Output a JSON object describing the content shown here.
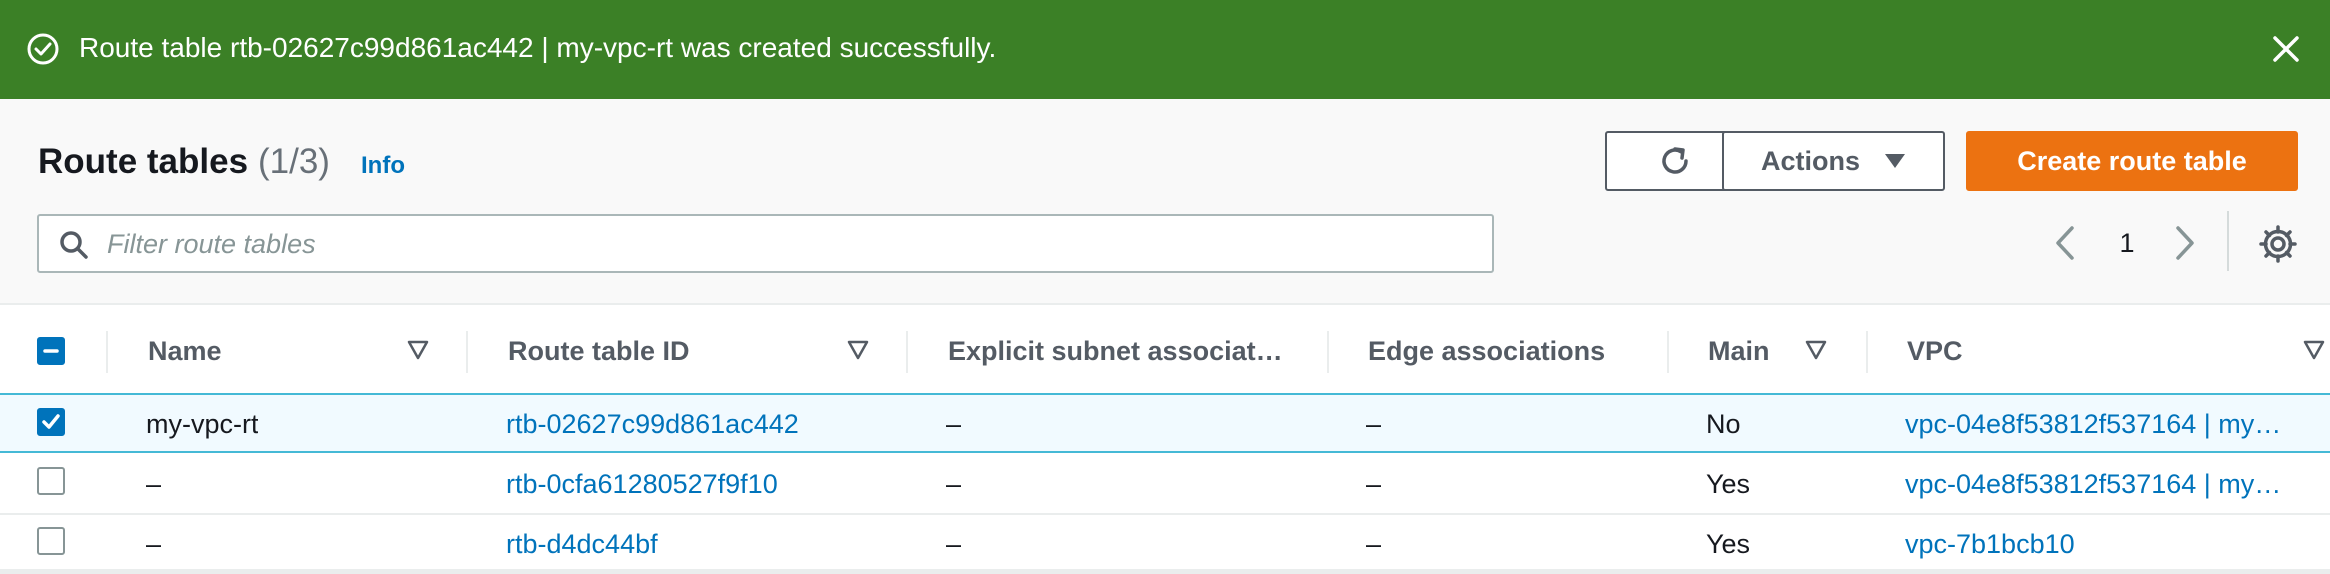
{
  "flash": {
    "message": "Route table rtb-02627c99d861ac442 | my-vpc-rt was created successfully.",
    "type": "success",
    "color": "#3b8026",
    "icon": "check-circle-icon",
    "close_icon": "close-icon"
  },
  "header": {
    "title": "Route tables",
    "count": "(1/3)",
    "info": "Info"
  },
  "toolbar": {
    "refresh_icon": "refresh-icon",
    "actions_label": "Actions",
    "create_label": "Create route table",
    "accent": "#ec7211"
  },
  "filter": {
    "placeholder": "Filter route tables",
    "value": ""
  },
  "pagination": {
    "current_page": "1"
  },
  "table": {
    "columns": [
      {
        "label": "Name",
        "sortable": true
      },
      {
        "label": "Route table ID",
        "sortable": true
      },
      {
        "label": "Explicit subnet associat…",
        "sortable": false
      },
      {
        "label": "Edge associations",
        "sortable": false
      },
      {
        "label": "Main",
        "sortable": true
      },
      {
        "label": "VPC",
        "sortable": true
      }
    ],
    "rows": [
      {
        "selected": true,
        "name": "my-vpc-rt",
        "route_table_id": "rtb-02627c99d861ac442",
        "explicit_subnet": "–",
        "edge": "–",
        "main": "No",
        "vpc": "vpc-04e8f53812f537164 | my…"
      },
      {
        "selected": false,
        "name": "–",
        "route_table_id": "rtb-0cfa61280527f9f10",
        "explicit_subnet": "–",
        "edge": "–",
        "main": "Yes",
        "vpc": "vpc-04e8f53812f537164 | my…"
      },
      {
        "selected": false,
        "name": "–",
        "route_table_id": "rtb-d4dc44bf",
        "explicit_subnet": "–",
        "edge": "–",
        "main": "Yes",
        "vpc": "vpc-7b1bcb10"
      }
    ]
  }
}
